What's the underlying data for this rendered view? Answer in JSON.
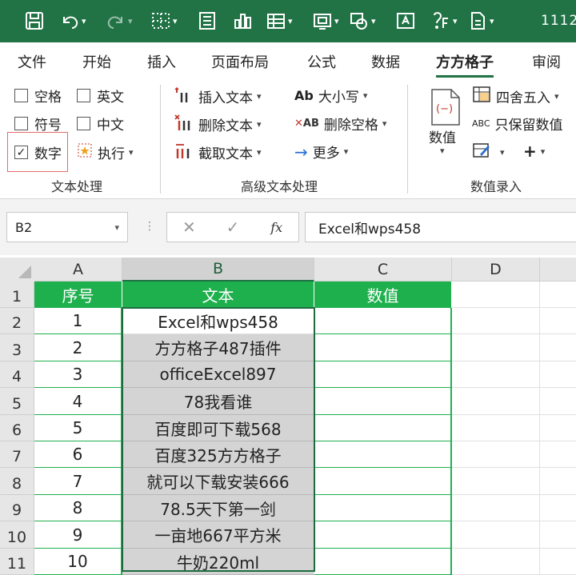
{
  "qat": {
    "icons": [
      "save-icon",
      "undo-icon",
      "redo-icon",
      "borders-icon",
      "form-icon",
      "chart-icon",
      "table-icon",
      "screenshot-icon",
      "shapes-icon",
      "textbox-icon",
      "symbol-icon",
      "document-icon"
    ],
    "title_fragment": "1112"
  },
  "tabs": [
    "文件",
    "开始",
    "插入",
    "页面布局",
    "公式",
    "数据",
    "方方格子",
    "审阅"
  ],
  "active_tab": "方方格子",
  "ribbon": {
    "text_group": {
      "space": "空格",
      "english": "英文",
      "symbol": "符号",
      "chinese": "中文",
      "number": "数字",
      "number_checked": true,
      "execute": "执行",
      "label": "文本处理"
    },
    "advanced_group": {
      "insert_text": "插入文本",
      "delete_text": "删除文本",
      "extract_text": "截取文本",
      "case": "大小写",
      "delete_space": "删除空格",
      "more": "更多",
      "label": "高级文本处理"
    },
    "value_group": {
      "value": "数值",
      "round": "四舍五入",
      "keep_value": "只保留数值",
      "plus": "+",
      "label": "数值录入",
      "abc": "ABC",
      "ab": "Ab",
      "ab2": "AB",
      "paren": "(−)"
    }
  },
  "formula_bar": {
    "name_box": "B2",
    "cancel": "✕",
    "confirm": "✓",
    "fx": "fx",
    "content": "Excel和wps458"
  },
  "sheet": {
    "columns": [
      "A",
      "B",
      "C",
      "D"
    ],
    "headers": [
      "序号",
      "文本",
      "数值"
    ],
    "rows": [
      {
        "num": "2",
        "a": "1",
        "b": "Excel和wps458"
      },
      {
        "num": "3",
        "a": "2",
        "b": "方方格子487插件"
      },
      {
        "num": "4",
        "a": "3",
        "b": "officeExcel897"
      },
      {
        "num": "5",
        "a": "4",
        "b": "78我看谁"
      },
      {
        "num": "6",
        "a": "5",
        "b": "百度即可下载568"
      },
      {
        "num": "7",
        "a": "6",
        "b": "百度325方方格子"
      },
      {
        "num": "8",
        "a": "7",
        "b": "就可以下载安装666"
      },
      {
        "num": "9",
        "a": "8",
        "b": "78.5天下第一剑"
      },
      {
        "num": "10",
        "a": "9",
        "b": "一亩地667平方米"
      },
      {
        "num": "11",
        "a": "10",
        "b": "牛奶220ml"
      }
    ],
    "header_row_num": "1",
    "colors": {
      "header_green": "#1fb04e",
      "ribbon_green": "#217346",
      "selection_gray": "#d4d4d4"
    }
  }
}
